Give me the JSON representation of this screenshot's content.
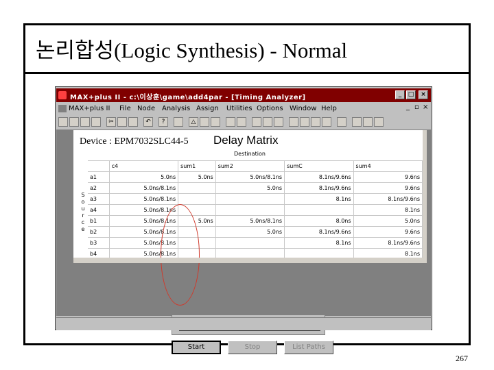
{
  "slide": {
    "title": "논리합성(Logic Synthesis) - Normal",
    "page_number": "267"
  },
  "window": {
    "title": "MAX+plus II - c:\\이상훈\\game\\add4par - [Timing Analyzer]",
    "menu": [
      "MAX+plus II",
      "File",
      "Node",
      "Analysis",
      "Assign",
      "Utilities",
      "Options",
      "Window",
      "Help"
    ]
  },
  "colors": {
    "title_bar": "#800000",
    "highlight": "#d0392b",
    "progress": "#8b0000"
  },
  "timing": {
    "device_label": "Device : EPM7032SLC44-5",
    "view_title": "Delay Matrix",
    "destination_label": "Destination",
    "source_label": "Source",
    "columns": [
      "",
      "c4",
      "sum1",
      "sum2",
      "sumC",
      "sum4"
    ],
    "rows": [
      {
        "src": "a1",
        "c4": "5.0ns",
        "sum1": "5.0ns",
        "sum2": "5.0ns/8.1ns",
        "sumC": "8.1ns/9.6ns",
        "sum4": "9.6ns"
      },
      {
        "src": "a2",
        "c4": "5.0ns/8.1ns",
        "sum1": "",
        "sum2": "5.0ns",
        "sumC": "8.1ns/9.6ns",
        "sum4": "9.6ns"
      },
      {
        "src": "a3",
        "c4": "5.0ns/8.1ns",
        "sum1": "",
        "sum2": "",
        "sumC": "8.1ns",
        "sum4": "8.1ns/9.6ns"
      },
      {
        "src": "a4",
        "c4": "5.0ns/8.1ns",
        "sum1": "",
        "sum2": "",
        "sumC": "",
        "sum4": "8.1ns"
      },
      {
        "src": "b1",
        "c4": "5.0ns/8.1ns",
        "sum1": "5.0ns",
        "sum2": "5.0ns/8.1ns",
        "sumC": "8.0ns",
        "sum4": "5.0ns"
      },
      {
        "src": "b2",
        "c4": "5.0ns/8.1ns",
        "sum1": "",
        "sum2": "5.0ns",
        "sumC": "8.1ns/9.6ns",
        "sum4": "9.6ns"
      },
      {
        "src": "b3",
        "c4": "5.0ns/8.1ns",
        "sum1": "",
        "sum2": "",
        "sumC": "8.1ns",
        "sum4": "8.1ns/9.6ns"
      },
      {
        "src": "b4",
        "c4": "5.0ns/8.1ns",
        "sum1": "",
        "sum2": "",
        "sumC": "",
        "sum4": "8.1ns"
      }
    ],
    "progress": {
      "value": 0,
      "ticks": [
        "0",
        "50",
        "100"
      ]
    },
    "buttons": {
      "start": "Start",
      "stop": "Stop",
      "list_paths": "List Paths"
    }
  }
}
